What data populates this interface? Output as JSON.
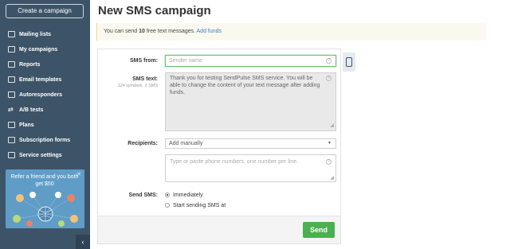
{
  "sidebar": {
    "create_button": "Create a campaign",
    "items": [
      {
        "label": "Mailing lists",
        "icon": "list-icon"
      },
      {
        "label": "My campaigns",
        "icon": "envelope-icon"
      },
      {
        "label": "Reports",
        "icon": "chart-icon"
      },
      {
        "label": "Email templates",
        "icon": "template-icon"
      },
      {
        "label": "Autoresponders",
        "icon": "autoresponder-icon"
      },
      {
        "label": "A/B tests",
        "icon": "ab-test-icon"
      },
      {
        "label": "Plans",
        "icon": "plans-icon"
      },
      {
        "label": "Subscription forms",
        "icon": "form-icon"
      },
      {
        "label": "Service settings",
        "icon": "settings-icon"
      }
    ],
    "promo": {
      "text": "Refer a friend and you both get $50",
      "close": "✕"
    },
    "collapse_icon": "‹"
  },
  "main": {
    "title": "New SMS campaign",
    "notice": {
      "prefix": "You can send ",
      "count": "10",
      "suffix": " free text messages. ",
      "link": "Add funds"
    },
    "form": {
      "sms_from_label": "SMS from:",
      "sms_from_placeholder": "Sender name",
      "sms_text_label": "SMS text:",
      "sms_text_counter": "124 symbols, 1 SMS",
      "sms_text_value": "Thank you for testing SendPulse SMS service. You will be able to change the content of your text message after adding funds.",
      "recipients_label": "Recipients:",
      "recipients_selected": "Add manually",
      "phones_placeholder": "Type or paste phone numbers, one number per line.",
      "send_sms_label": "Send SMS:",
      "option_immediately": "Immediately",
      "option_schedule": "Start sending SMS at",
      "send_button": "Send"
    }
  },
  "colors": {
    "sidebar_bg": "#3d5468",
    "accent_green": "#4caf50",
    "link_blue": "#3b7bc4",
    "notice_bg": "#fbf9ef"
  }
}
